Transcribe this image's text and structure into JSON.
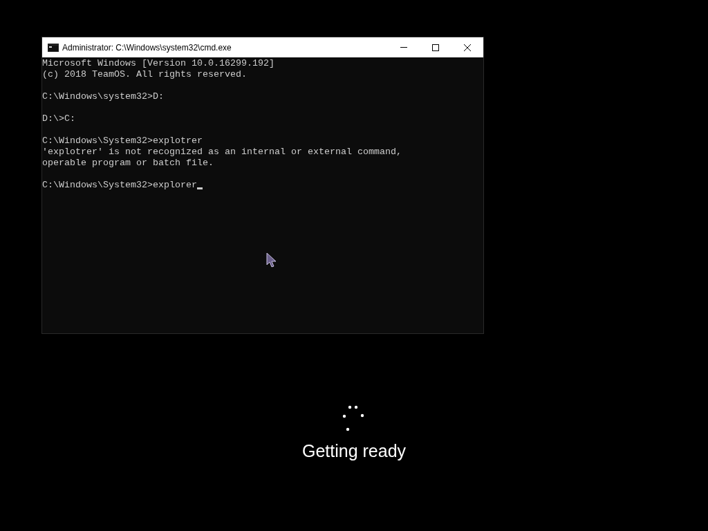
{
  "window": {
    "title": "Administrator: C:\\Windows\\system32\\cmd.exe"
  },
  "console": {
    "blocks": [
      [
        "Microsoft Windows [Version 10.0.16299.192]",
        "(c) 2018 TeamOS. All rights reserved."
      ],
      [
        "C:\\Windows\\system32>D:"
      ],
      [
        "D:\\>C:"
      ],
      [
        "C:\\Windows\\System32>explotrer",
        "'explotrer' is not recognized as an internal or external command,",
        "operable program or batch file."
      ]
    ],
    "input": "C:\\Windows\\System32>explorer"
  },
  "status": {
    "text": "Getting ready"
  }
}
